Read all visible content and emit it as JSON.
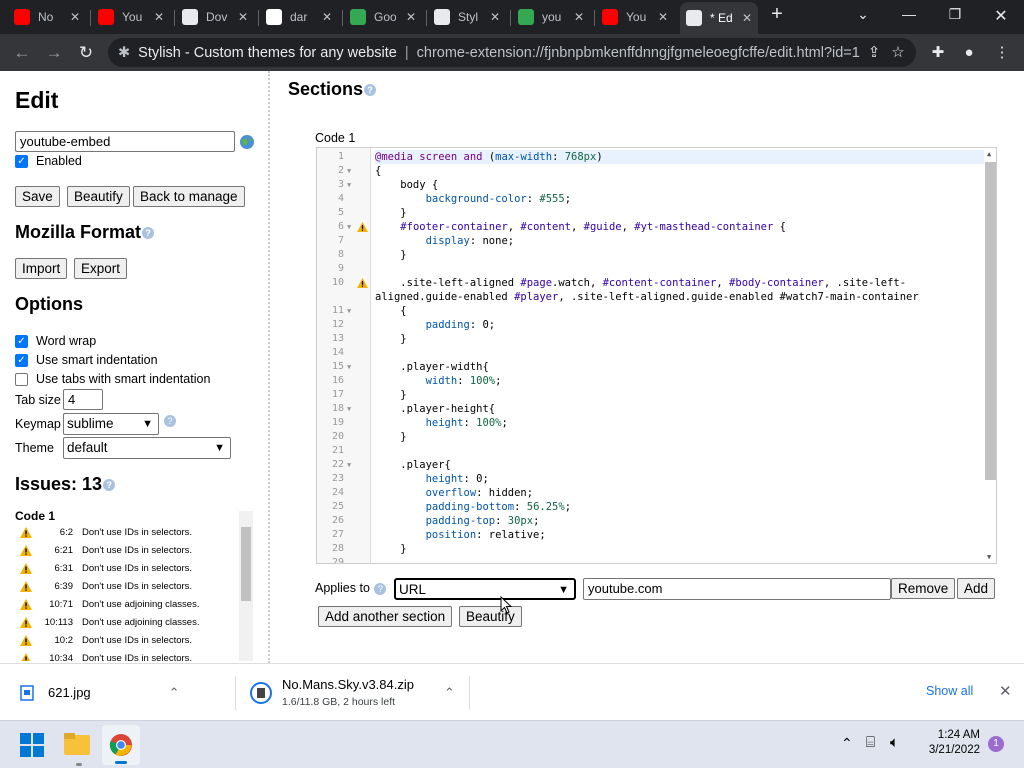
{
  "browser": {
    "tabs": [
      {
        "title": "No",
        "icon": "youtube-icon",
        "color": "#ff0000"
      },
      {
        "title": "You",
        "icon": "youtube-icon",
        "color": "#ff0000"
      },
      {
        "title": "Dov",
        "icon": "download-icon",
        "color": "#e8eaed"
      },
      {
        "title": "dar",
        "icon": "google-icon",
        "color": "#ffffff"
      },
      {
        "title": "Goo",
        "icon": "google-sheets-icon",
        "color": "#34a853"
      },
      {
        "title": "Styl",
        "icon": "stylish-icon",
        "color": "#e8eaed"
      },
      {
        "title": "you",
        "icon": "google-sheets-icon",
        "color": "#34a853"
      },
      {
        "title": "You",
        "icon": "youtube-icon",
        "color": "#ff0000"
      },
      {
        "title": "* Edi",
        "icon": "stylish-icon",
        "color": "#e8eaed",
        "active": true
      }
    ],
    "page_title": "Stylish - Custom themes for any website",
    "url": "chrome-extension://fjnbnpbmkenffdnngjfgmeleoegfcffe/edit.html?id=1"
  },
  "left": {
    "heading": "Edit",
    "name_value": "youtube-embed",
    "enabled_label": "Enabled",
    "save_label": "Save",
    "beautify_label": "Beautify",
    "back_label": "Back to manage",
    "mozilla_heading": "Mozilla Format",
    "import_label": "Import",
    "export_label": "Export",
    "options_heading": "Options",
    "word_wrap_label": "Word wrap",
    "smart_indent_label": "Use smart indentation",
    "tabs_indent_label": "Use tabs with smart indentation",
    "tab_size_label": "Tab size",
    "tab_size_value": "4",
    "keymap_label": "Keymap",
    "keymap_value": "sublime",
    "theme_label": "Theme",
    "theme_value": "default",
    "issues_heading": "Issues: 13",
    "issues_code_label": "Code 1",
    "issues": [
      {
        "pos": "6:2",
        "msg": "Don't use IDs in selectors."
      },
      {
        "pos": "6:21",
        "msg": "Don't use IDs in selectors."
      },
      {
        "pos": "6:31",
        "msg": "Don't use IDs in selectors."
      },
      {
        "pos": "6:39",
        "msg": "Don't use IDs in selectors."
      },
      {
        "pos": "10:71",
        "msg": "Don't use adjoining classes."
      },
      {
        "pos": "10:113",
        "msg": "Don't use adjoining classes."
      },
      {
        "pos": "10:2",
        "msg": "Don't use IDs in selectors."
      },
      {
        "pos": "10:34",
        "msg": "Don't use IDs in selectors."
      }
    ]
  },
  "main": {
    "sections_heading": "Sections",
    "code_label": "Code 1",
    "code_lines": [
      {
        "n": "1",
        "fold": false,
        "t": "@media screen and (max-width: 768px)"
      },
      {
        "n": "2",
        "fold": true,
        "t": "{"
      },
      {
        "n": "3",
        "fold": true,
        "t": "    body {"
      },
      {
        "n": "4",
        "fold": false,
        "t": "        background-color: #555;"
      },
      {
        "n": "5",
        "fold": false,
        "t": "    }"
      },
      {
        "n": "6",
        "fold": true,
        "warn": true,
        "t": "    #footer-container, #content, #guide, #yt-masthead-container {"
      },
      {
        "n": "7",
        "fold": false,
        "t": "        display: none;"
      },
      {
        "n": "8",
        "fold": false,
        "t": "    }"
      },
      {
        "n": "9",
        "fold": false,
        "t": ""
      },
      {
        "n": "10",
        "fold": false,
        "warn": true,
        "t": "    .site-left-aligned #page.watch, #content-container, #body-container, .site-left-"
      },
      {
        "n": "",
        "fold": false,
        "t": "aligned.guide-enabled #player, .site-left-aligned.guide-enabled #watch7-main-container"
      },
      {
        "n": "11",
        "fold": true,
        "t": "    {"
      },
      {
        "n": "12",
        "fold": false,
        "t": "        padding: 0;"
      },
      {
        "n": "13",
        "fold": false,
        "t": "    }"
      },
      {
        "n": "14",
        "fold": false,
        "t": ""
      },
      {
        "n": "15",
        "fold": true,
        "t": "    .player-width{"
      },
      {
        "n": "16",
        "fold": false,
        "t": "        width: 100%;"
      },
      {
        "n": "17",
        "fold": false,
        "t": "    }"
      },
      {
        "n": "18",
        "fold": true,
        "t": "    .player-height{"
      },
      {
        "n": "19",
        "fold": false,
        "t": "        height: 100%;"
      },
      {
        "n": "20",
        "fold": false,
        "t": "    }"
      },
      {
        "n": "21",
        "fold": false,
        "t": ""
      },
      {
        "n": "22",
        "fold": true,
        "t": "    .player{"
      },
      {
        "n": "23",
        "fold": false,
        "t": "        height: 0;"
      },
      {
        "n": "24",
        "fold": false,
        "t": "        overflow: hidden;"
      },
      {
        "n": "25",
        "fold": false,
        "t": "        padding-bottom: 56.25%;"
      },
      {
        "n": "26",
        "fold": false,
        "t": "        padding-top: 30px;"
      },
      {
        "n": "27",
        "fold": false,
        "t": "        position: relative;"
      },
      {
        "n": "28",
        "fold": false,
        "t": "    }"
      },
      {
        "n": "29",
        "fold": false,
        "t": ""
      }
    ],
    "applies_label": "Applies to",
    "applies_type": "URL",
    "applies_value": "youtube.com",
    "remove_label": "Remove",
    "add_label": "Add",
    "add_section_label": "Add another section",
    "beautify_label": "Beautify"
  },
  "downloads": {
    "items": [
      {
        "name": "621.jpg",
        "status": ""
      },
      {
        "name": "No.Mans.Sky.v3.84.zip",
        "status": "1.6/11.8 GB, 2 hours left"
      }
    ],
    "show_all_label": "Show all"
  },
  "taskbar": {
    "time": "1:24 AM",
    "date": "3/21/2022",
    "notification_count": "1"
  }
}
